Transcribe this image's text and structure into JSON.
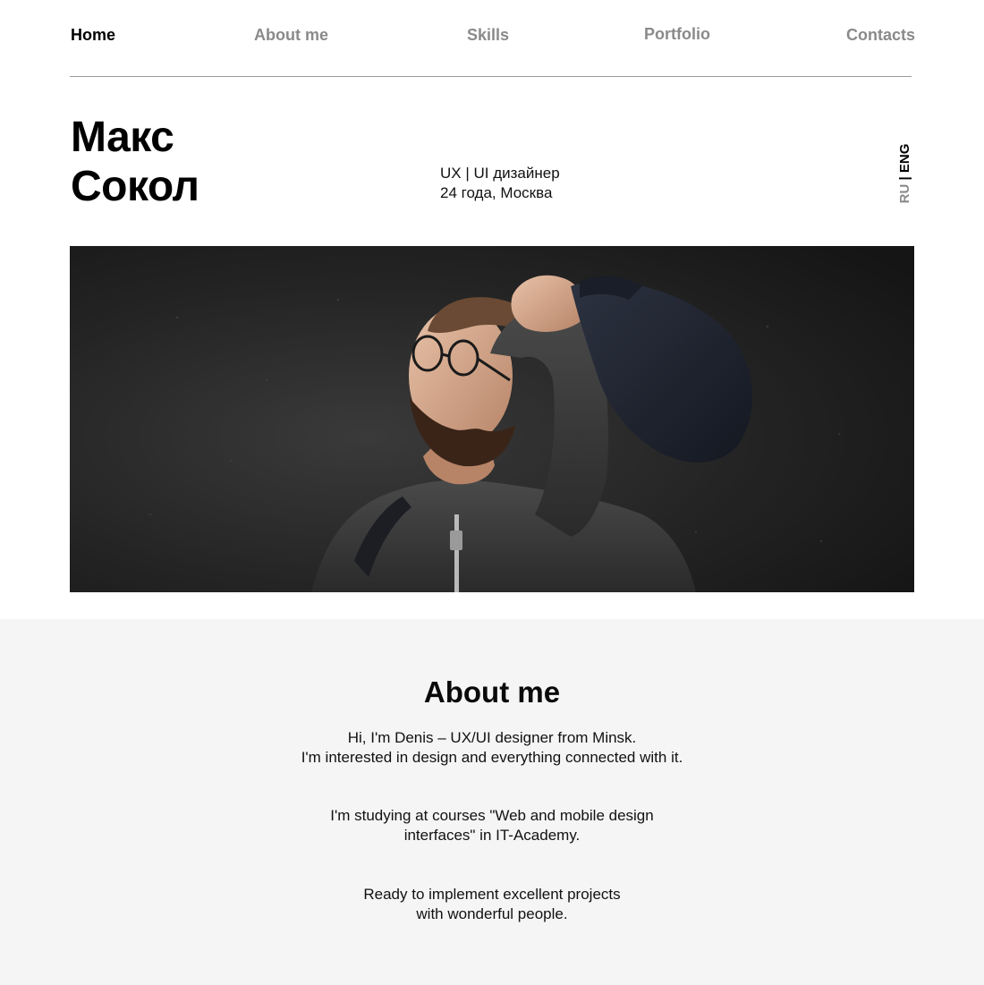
{
  "nav": {
    "items": [
      {
        "label": "Home",
        "active": true
      },
      {
        "label": "About me",
        "active": false
      },
      {
        "label": "Skills",
        "active": false
      },
      {
        "label": "Portfolio",
        "active": false
      },
      {
        "label": "Contacts",
        "active": false
      }
    ]
  },
  "hero": {
    "name_line1": "Макс",
    "name_line2": "Сокол",
    "role": "UX | UI дизайнер",
    "age_city": "24 года, Москва",
    "photo_icon": "portrait-photo"
  },
  "language": {
    "ru": "RU",
    "separator": "|",
    "eng": "ENG",
    "active": "ENG"
  },
  "about": {
    "title": "About me",
    "p1_line1": "Hi, I'm Denis – UX/UI designer from Minsk.",
    "p1_line2": "I'm interested in design and everything connected with it.",
    "p2_line1": "I'm studying at courses \"Web and mobile design",
    "p2_line2": "interfaces\" in IT-Academy.",
    "p3_line1": "Ready to implement excellent projects",
    "p3_line2": "with wonderful people."
  },
  "colors": {
    "active_nav": "#000000",
    "inactive_nav": "#8a8a8a",
    "divider": "#9a9a9a",
    "about_bg": "#f5f5f5"
  }
}
